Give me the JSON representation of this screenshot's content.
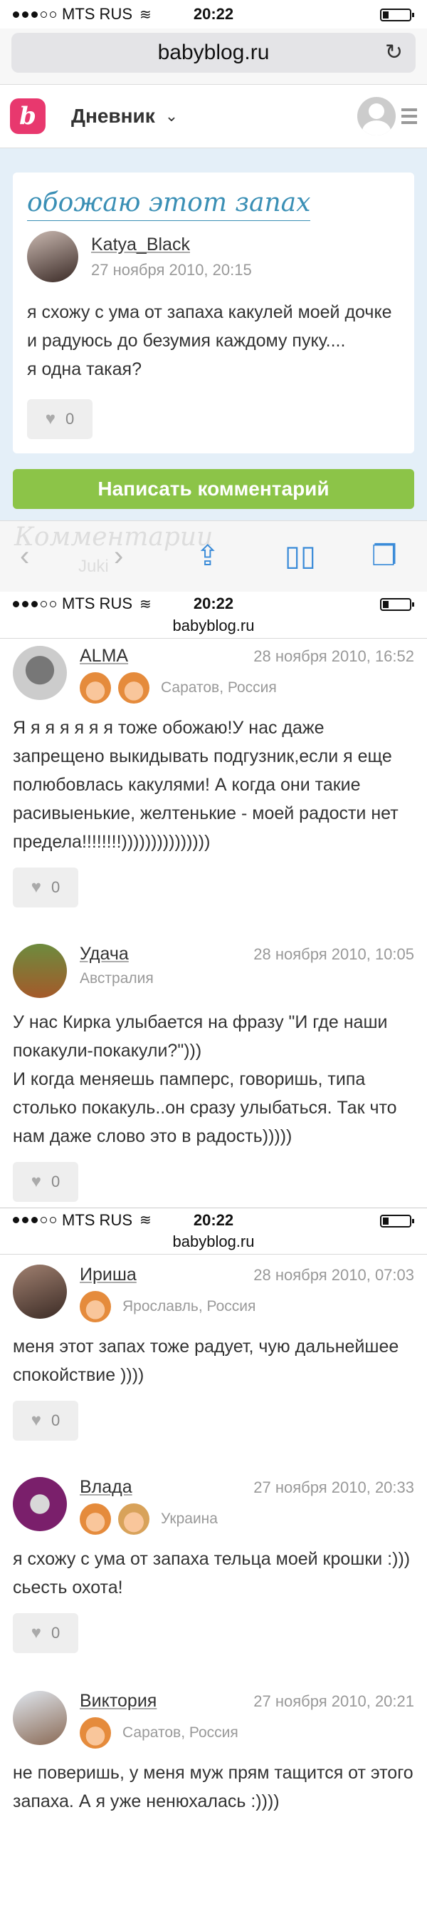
{
  "shot1": {
    "status": {
      "carrier": "MTS RUS",
      "time": "20:22"
    },
    "url": "babyblog.ru",
    "header": {
      "title": "Дневник"
    },
    "post": {
      "title": "обожаю этот запах",
      "author": "Katya_Black",
      "date": "27 ноября 2010, 20:15",
      "text": "я схожу с ума от запаха какулей моей дочке и радуюсь до безумия каждому пуку....\nя одна такая?",
      "likes": "0"
    },
    "comment_button": "Написать комментарий",
    "behind_toolbar": {
      "heading": "Комментарии",
      "author": "Juki"
    }
  },
  "shot2": {
    "status": {
      "carrier": "MTS RUS",
      "time": "20:22"
    },
    "url": "babyblog.ru",
    "comments": [
      {
        "name": "ALMA",
        "date": "28 ноября 2010, 16:52",
        "location": "Саратов, Россия",
        "text": "Я я я я я я я тоже обожаю!У нас даже запрещено выкидывать подгузник,если я еще полюбовлась какулями! А когда они такие расивыенькие, желтенькие - моей радости нет предела!!!!!!!!)))))))))))))))",
        "likes": "0"
      },
      {
        "name": "Удача",
        "date": "28 ноября 2010, 10:05",
        "location": "Австралия",
        "text": "У нас Кирка улыбается на  фразу \"И где наши покакули-покакули?\")))\nИ когда меняешь памперс, говоришь, типа столько покакуль..он сразу улыбаться. Так что нам даже слово это в радость)))))",
        "likes": "0"
      }
    ]
  },
  "shot3": {
    "status": {
      "carrier": "MTS RUS",
      "time": "20:22"
    },
    "url": "babyblog.ru",
    "comments": [
      {
        "name": "Ириша",
        "date": "28 ноября 2010, 07:03",
        "location": "Ярославль, Россия",
        "text": "меня этот запах тоже радует, чую дальнейшее спокойствие ))))",
        "likes": "0"
      },
      {
        "name": "Влада",
        "date": "27 ноября 2010, 20:33",
        "location": "Украина",
        "text": "я схожу с ума от запаха тельца моей крошки :))) сьесть охота!",
        "likes": "0"
      },
      {
        "name": "Виктория",
        "date": "27 ноября 2010, 20:21",
        "location": "Саратов, Россия",
        "text": "не поверишь, у меня муж прям тащится от этого запаха. А я уже ненюхалась :))))"
      }
    ]
  }
}
